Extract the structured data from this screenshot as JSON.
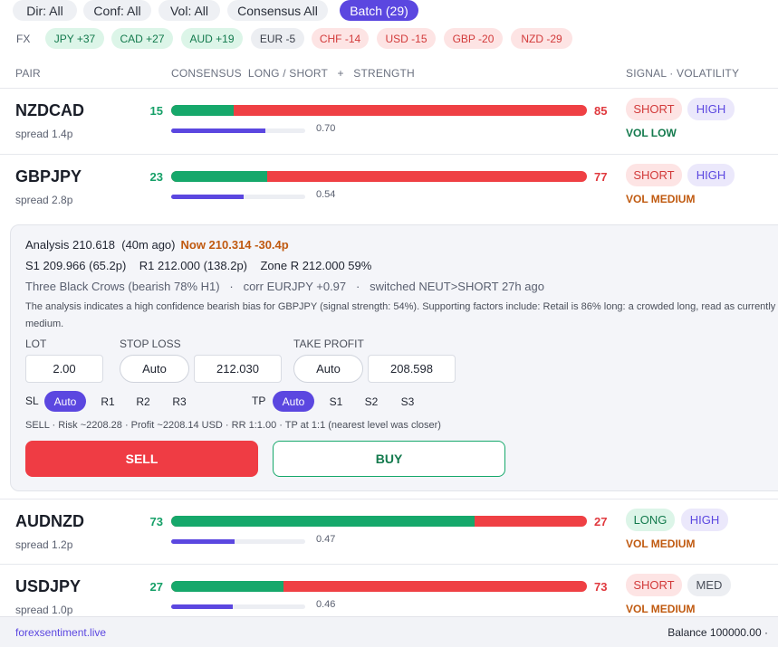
{
  "filters": [
    "Dir: All",
    "Conf: All",
    "Vol: All",
    "Consensus All",
    "Batch (29)"
  ],
  "fx": {
    "label": "FX",
    "chips": [
      {
        "text": "JPY +37",
        "tone": "pos"
      },
      {
        "text": "CAD +27",
        "tone": "pos"
      },
      {
        "text": "AUD +19",
        "tone": "pos"
      },
      {
        "text": "EUR -5",
        "tone": "neu"
      },
      {
        "text": "CHF -14",
        "tone": "neg"
      },
      {
        "text": "USD -15",
        "tone": "neg"
      },
      {
        "text": "GBP -20",
        "tone": "neg"
      },
      {
        "text": "NZD -29",
        "tone": "neg"
      }
    ]
  },
  "columns": {
    "pair": "PAIR",
    "consensus": "CONSENSUS  LONG / SHORT   +   STRENGTH",
    "signal": "SIGNAL  ·  VOLATILITY"
  },
  "rows": [
    {
      "pair": "NZDCAD",
      "spread": "spread 1.4p",
      "long": 15,
      "short": 85,
      "strength": 0.7,
      "strength_text": "0.70",
      "signal": "SHORT",
      "vol_badge": "HIGH",
      "vol_text": "VOL LOW"
    },
    {
      "pair": "GBPJPY",
      "spread": "spread 2.8p",
      "long": 23,
      "short": 77,
      "strength": 0.54,
      "strength_text": "0.54",
      "signal": "SHORT",
      "vol_badge": "HIGH",
      "vol_text": "VOL MEDIUM"
    },
    {
      "pair": "AUDNZD",
      "spread": "spread 1.2p",
      "long": 73,
      "short": 27,
      "strength": 0.47,
      "strength_text": "0.47",
      "signal": "LONG",
      "vol_badge": "HIGH",
      "vol_text": "VOL MEDIUM"
    },
    {
      "pair": "USDJPY",
      "spread": "spread 1.0p",
      "long": 27,
      "short": 73,
      "strength": 0.46,
      "strength_text": "0.46",
      "signal": "SHORT",
      "vol_badge": "MED",
      "vol_text": "VOL MEDIUM"
    }
  ],
  "detail": {
    "analysis": "Analysis 210.618  (40m ago)",
    "now": "Now 210.314 -30.4p",
    "levels": "S1 209.966 (65.2p)    R1 212.000 (138.2p)    Zone R 212.000 59%",
    "pattern": "Three Black Crows (bearish 78% H1)   ·   corr EURJPY +0.97   ·   switched NEUT>SHORT 27h ago",
    "description": "The analysis indicates a high confidence bearish bias for GBPJPY (signal strength: 54%). Supporting factors include: Retail is 86% long: a crowded long, read as currently medium.",
    "lot_label": "LOT",
    "lot_value": "2.00",
    "sl_label": "STOP LOSS",
    "sl_mode": "Auto",
    "sl_value": "212.030",
    "tp_label": "TAKE PROFIT",
    "tp_mode": "Auto",
    "tp_value": "208.598",
    "sl_short": "SL",
    "sl_options": [
      "Auto",
      "R1",
      "R2",
      "R3"
    ],
    "tp_short": "TP",
    "tp_options": [
      "Auto",
      "S1",
      "S2",
      "S3"
    ],
    "summary": "SELL  ·  Risk ~2208.28  ·  Profit ~2208.14 USD  ·  RR 1:1.00  ·  TP at 1:1 (nearest level was closer)",
    "sell_label": "SELL",
    "buy_label": "BUY"
  },
  "footer": {
    "brand": "forexsentiment.live",
    "balance": "Balance 100000.00  ·"
  },
  "colors": {
    "accent": "#5b47e0",
    "long": "#16a86b",
    "short": "#ef4044"
  }
}
